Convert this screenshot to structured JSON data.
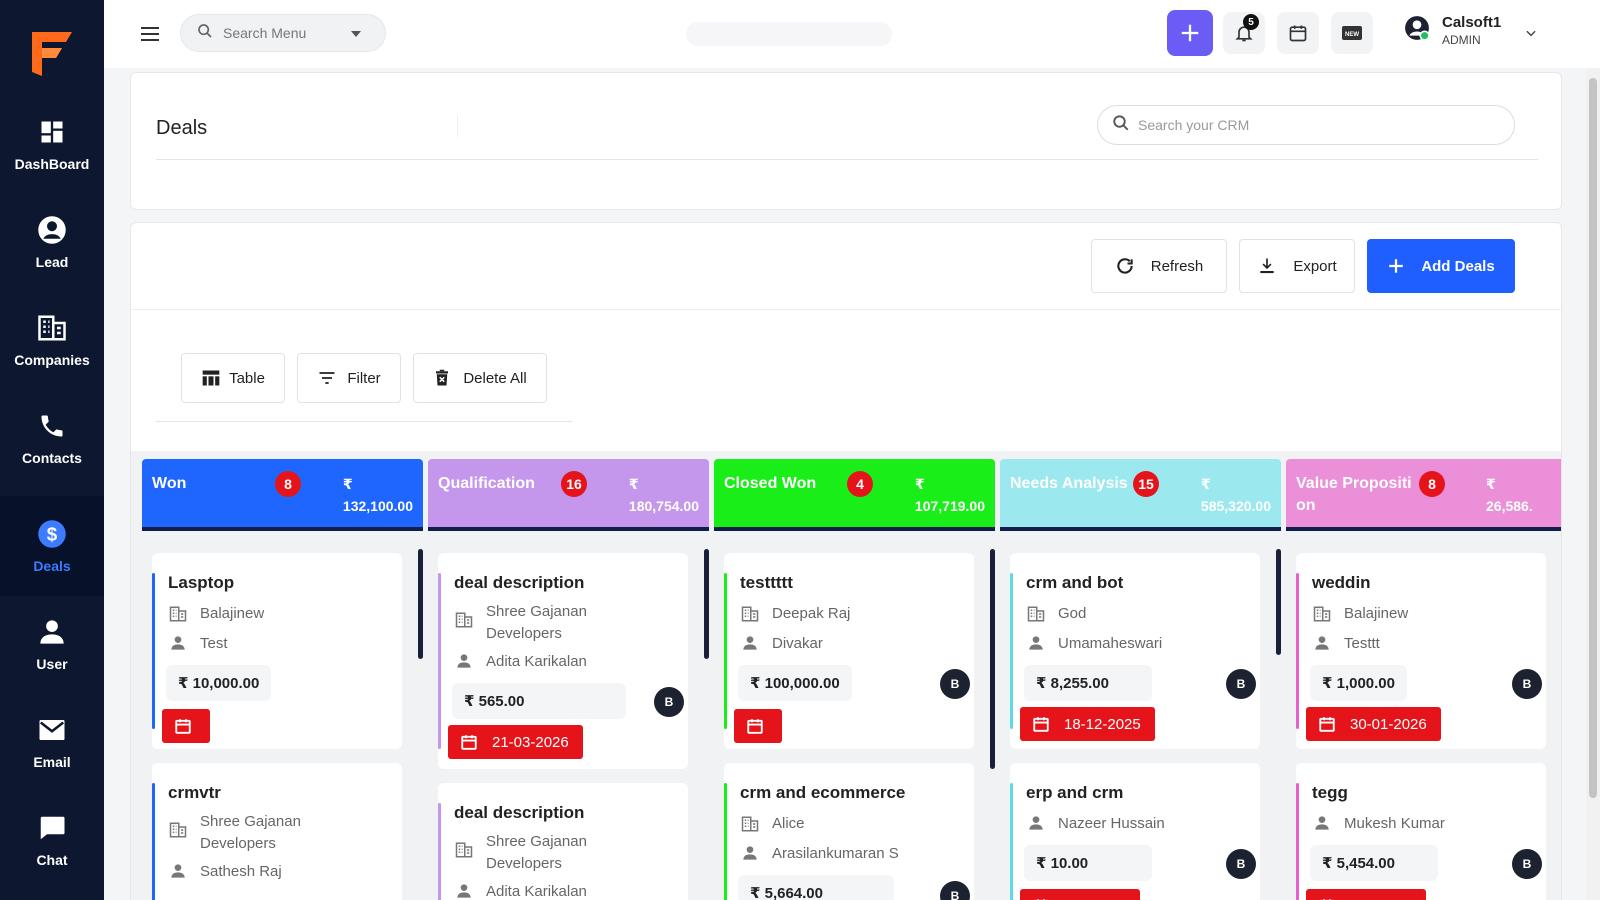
{
  "colors": {
    "sidebar_bg": "#0d1730",
    "primary": "#1f5eff",
    "accent_purple": "#6b5cf6",
    "badge_red": "#e4141a"
  },
  "sidebar": {
    "items": [
      {
        "label": "DashBoard",
        "icon": "dashboard-icon"
      },
      {
        "label": "Lead",
        "icon": "user-circle-icon"
      },
      {
        "label": "Companies",
        "icon": "building-icon"
      },
      {
        "label": "Contacts",
        "icon": "phone-icon"
      },
      {
        "label": "Deals",
        "icon": "dollar-icon",
        "active": true
      },
      {
        "label": "User",
        "icon": "person-icon"
      },
      {
        "label": "Email",
        "icon": "mail-icon"
      },
      {
        "label": "Chat",
        "icon": "chat-icon"
      }
    ]
  },
  "header": {
    "menu_search_placeholder": "Search Menu",
    "notification_count": "5",
    "user_name": "Calsoft1",
    "user_role": "ADMIN"
  },
  "deals_header": {
    "title": "Deals",
    "search_placeholder": "Search your CRM"
  },
  "toolbar": {
    "refresh_label": "Refresh",
    "export_label": "Export",
    "add_label": "Add Deals",
    "table_label": "Table",
    "filter_label": "Filter",
    "delete_all_label": "Delete All"
  },
  "currency": "₹",
  "columns": [
    {
      "title": "Won",
      "count": "8",
      "amount": "132,100.00",
      "color": "#1f66ff",
      "deals": [
        {
          "title": "Lasptop",
          "company": "Balajinew",
          "contact": "Test",
          "amount": "₹ 10,000.00",
          "date": "",
          "avatar": ""
        },
        {
          "title": "crmvtr",
          "company": "Shree Gajanan Developers",
          "contact": "Sathesh Raj",
          "amount": "",
          "date": "",
          "avatar": ""
        }
      ]
    },
    {
      "title": "Qualification",
      "count": "16",
      "amount": "180,754.00",
      "color": "#c597ec",
      "deals": [
        {
          "title": "deal description",
          "company": "Shree Gajanan Developers",
          "contact": "Adita Karikalan",
          "amount": "₹ 565.00",
          "date": "21-03-2026",
          "avatar": "B"
        },
        {
          "title": "deal description",
          "company": "Shree Gajanan Developers",
          "contact": "Adita Karikalan",
          "amount": "",
          "date": "",
          "avatar": ""
        }
      ]
    },
    {
      "title": "Closed Won",
      "count": "4",
      "amount": "107,719.00",
      "color": "#19ee19",
      "deals": [
        {
          "title": "testtttt",
          "company": "Deepak Raj",
          "contact": "Divakar",
          "amount": "₹ 100,000.00",
          "date": "",
          "avatar": "B"
        },
        {
          "title": "crm and ecommerce",
          "company": "Alice",
          "contact": "Arasilankumaran S",
          "amount": "₹ 5,664.00",
          "date": "",
          "avatar": "B"
        }
      ]
    },
    {
      "title": "Needs Analysis",
      "count": "15",
      "amount": "585,320.00",
      "color": "#9be9ee",
      "deals": [
        {
          "title": "crm and bot",
          "company": "God",
          "contact": "Umamaheswari",
          "amount": "₹ 8,255.00",
          "date": "18-12-2025",
          "avatar": "B"
        },
        {
          "title": "erp and crm",
          "company": "",
          "contact": "Nazeer Hussain",
          "amount": "₹ 10.00",
          "date": "",
          "avatar": "B"
        }
      ]
    },
    {
      "title": "Value Proposition",
      "count": "8",
      "amount": "26,586.",
      "color": "#ea8fd8",
      "deals": [
        {
          "title": "weddin",
          "company": "Balajinew",
          "contact": "Testtt",
          "amount": "₹ 1,000.00",
          "date": "30-01-2026",
          "avatar": "B"
        },
        {
          "title": "tegg",
          "company": "",
          "contact": "Mukesh Kumar",
          "amount": "₹ 5,454.00",
          "date": "",
          "avatar": "B"
        }
      ]
    }
  ]
}
